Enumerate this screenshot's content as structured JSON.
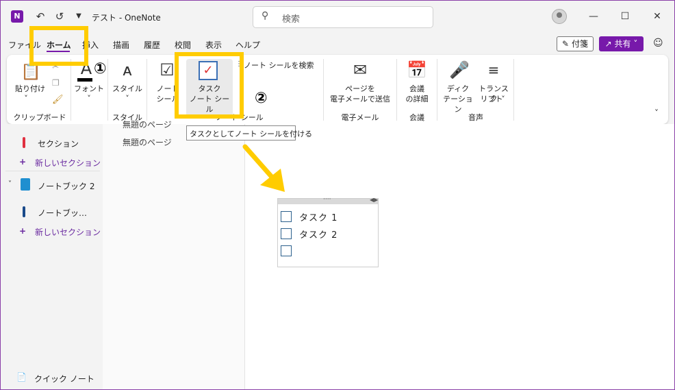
{
  "title_bar": {
    "app_icon_letter": "N",
    "doc_title": "テスト  -  OneNote",
    "search_placeholder": "検索",
    "back_icon": "back-icon",
    "undo_icon": "undo-icon"
  },
  "menu": {
    "items": [
      "ファイル",
      "ホーム",
      "挿入",
      "描画",
      "履歴",
      "校閲",
      "表示",
      "ヘルプ"
    ],
    "fusen_label": "付箋",
    "share_label": "共有"
  },
  "ribbon": {
    "paste_label": "貼り付け",
    "clipboard_group": "クリップボード",
    "font_label": "フォント",
    "style_label": "スタイル",
    "style_group": "スタイル",
    "notetag_label": "ノート\nシール",
    "task_label_1": "タスク",
    "task_label_2": "ノート シール",
    "search_tags_label": "ノート シールを検索",
    "tags_group": "ノート シール",
    "email_label_1": "ページを",
    "email_label_2": "電子メールで送信",
    "email_group": "電子メール",
    "meeting_label_1": "会議",
    "meeting_label_2": "の詳細",
    "meeting_group": "会議",
    "dictate_label_1": "ディク",
    "dictate_label_2": "テーション",
    "transcribe_label_1": "トランスク",
    "transcribe_label_2": "リプト",
    "voice_group": "音声"
  },
  "tooltip": "タスクとしてノート シールを付ける",
  "annotations": {
    "step1": "①",
    "step2": "②"
  },
  "nav": {
    "section_1": "セクション",
    "new_section_1": "新しいセクション",
    "notebook_2": "ノートブック 2",
    "section_2": "ノートブッ…",
    "new_section_2": "新しいセクション",
    "quick_note": "クイック ノート"
  },
  "pages": {
    "page_1": "無題のページ",
    "page_2": "無題のページ"
  },
  "note": {
    "tasks": [
      "タスク 1",
      "タスク 2",
      ""
    ]
  },
  "colors": {
    "accent": "#7719aa",
    "highlight": "#ffcc00"
  }
}
